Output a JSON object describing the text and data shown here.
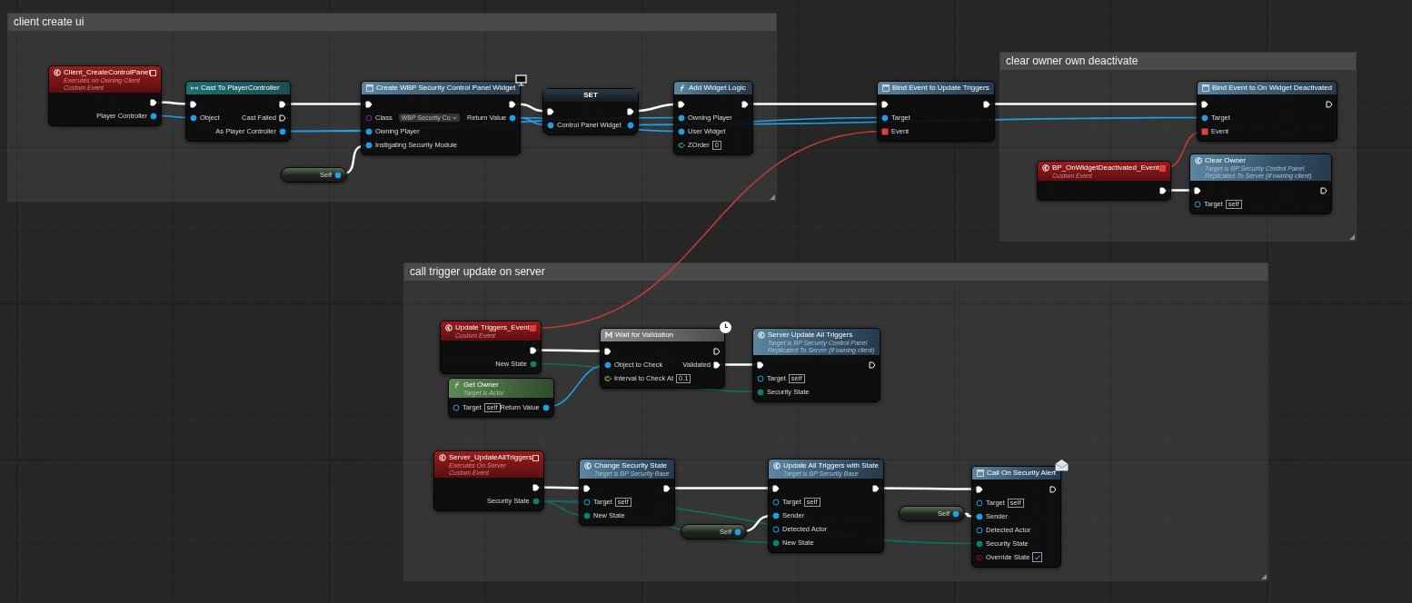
{
  "comments": [
    {
      "title": "client create ui",
      "nodes": [
        {
          "kind": "event",
          "title": "Client_CreateControlPanel",
          "subtitle": [
            "Executes on Owning Client",
            "Custom Event"
          ],
          "delegate": {
            "connected": false
          },
          "outputs": [
            {
              "kind": "exec",
              "connected": true
            },
            {
              "label": "Player Controller",
              "kind": "object",
              "connected": true
            }
          ]
        },
        {
          "kind": "cast",
          "title": "Cast To PlayerController",
          "inputs": [
            {
              "kind": "exec",
              "connected": true
            },
            {
              "label": "Object",
              "kind": "object",
              "connected": true
            }
          ],
          "outputs": [
            {
              "kind": "exec",
              "connected": true
            },
            {
              "label": "Cast Failed",
              "kind": "exec",
              "connected": false
            },
            {
              "label": "As Player Controller",
              "kind": "object",
              "connected": true
            }
          ]
        },
        {
          "kind": "widget",
          "title": "Create WBP Security Control Panel Widget",
          "badge": {
            "kind": "client"
          },
          "inputs": [
            {
              "kind": "exec",
              "connected": true
            },
            {
              "label": "Class",
              "kind": "class",
              "connected": false,
              "value": "WBP Security Co"
            },
            {
              "label": "Owning Player",
              "kind": "object",
              "connected": true
            },
            {
              "label": "Instigating Security Module",
              "kind": "object",
              "connected": true
            }
          ],
          "outputs": [
            {
              "kind": "exec",
              "connected": true
            },
            {
              "label": "Return Value",
              "kind": "object",
              "connected": true
            }
          ]
        },
        {
          "kind": "set",
          "title": "SET",
          "inputs": [
            {
              "kind": "exec",
              "connected": true
            },
            {
              "label": "Control Panel Widget",
              "kind": "object",
              "connected": true
            }
          ],
          "outputs": [
            {
              "kind": "exec",
              "connected": true
            },
            {
              "kind": "object",
              "connected": true
            }
          ]
        },
        {
          "kind": "function",
          "title": "Add Widget Logic",
          "inputs": [
            {
              "kind": "exec",
              "connected": true
            },
            {
              "label": "Owning Player",
              "kind": "object",
              "connected": true
            },
            {
              "label": "User Widget",
              "kind": "object",
              "connected": true
            },
            {
              "label": "ZOrder",
              "kind": "int",
              "connected": false,
              "value": "0"
            }
          ],
          "outputs": [
            {
              "kind": "exec",
              "connected": true
            }
          ]
        },
        {
          "kind": "widget",
          "title": "Bind Event to Update Triggers",
          "inputs": [
            {
              "kind": "exec",
              "connected": true
            },
            {
              "label": "Target",
              "kind": "object",
              "connected": true
            },
            {
              "label": "Event",
              "kind": "delegate",
              "connected": true
            }
          ],
          "outputs": [
            {
              "kind": "exec",
              "connected": true
            }
          ]
        },
        {
          "kind": "self",
          "outputs": [
            {
              "label": "Self",
              "kind": "object",
              "connected": true
            }
          ]
        }
      ]
    },
    {
      "title": "clear owner own deactivate",
      "nodes": [
        {
          "kind": "widget",
          "title": "Bind Event to On Widget Deactivated",
          "inputs": [
            {
              "kind": "exec",
              "connected": true
            },
            {
              "label": "Target",
              "kind": "object",
              "connected": true
            },
            {
              "label": "Event",
              "kind": "delegate",
              "connected": true
            }
          ],
          "outputs": [
            {
              "kind": "exec",
              "connected": false
            }
          ]
        },
        {
          "kind": "event",
          "title": "BP_OnWidgetDeactivated_Event",
          "subtitle": [
            "Custom Event"
          ],
          "delegate": {
            "connected": true
          },
          "outputs": [
            {
              "kind": "exec",
              "connected": true
            }
          ]
        },
        {
          "kind": "call",
          "title": "Clear Owner",
          "subtitle": [
            "Target is BP Security Control Panel",
            "Replicated To Server (if owning client)"
          ],
          "inputs": [
            {
              "kind": "exec",
              "connected": true
            },
            {
              "label": "Target",
              "kind": "object",
              "connected": false,
              "value": "self"
            }
          ],
          "outputs": [
            {
              "kind": "exec",
              "connected": false
            }
          ]
        }
      ]
    },
    {
      "title": "call trigger update on server",
      "nodes": [
        {
          "kind": "event",
          "title": "Update Triggers_Event",
          "subtitle": [
            "Custom Event"
          ],
          "delegate": {
            "connected": true
          },
          "outputs": [
            {
              "kind": "exec",
              "connected": true
            },
            {
              "label": "New State",
              "kind": "enum",
              "connected": true
            }
          ]
        },
        {
          "kind": "macro",
          "title": "Wait for Validation",
          "badge": {
            "kind": "latent"
          },
          "inputs": [
            {
              "kind": "exec",
              "connected": true
            },
            {
              "label": "Object to Check",
              "kind": "object",
              "connected": true
            },
            {
              "label": "Interval to Check At",
              "kind": "float",
              "connected": false,
              "value": "0.1"
            }
          ],
          "outputs": [
            {
              "kind": "exec",
              "connected": false
            },
            {
              "label": "Validated",
              "kind": "exec",
              "connected": true
            }
          ]
        },
        {
          "kind": "call",
          "title": "Server Update All Triggers",
          "subtitle": [
            "Target is BP Security Control Panel",
            "Replicated To Server (if owning client)"
          ],
          "inputs": [
            {
              "kind": "exec",
              "connected": true
            },
            {
              "label": "Target",
              "kind": "object",
              "connected": false,
              "value": "self"
            },
            {
              "label": "Security State",
              "kind": "enum",
              "connected": true
            }
          ],
          "outputs": [
            {
              "kind": "exec",
              "connected": false
            }
          ]
        },
        {
          "kind": "pure",
          "title": "Get Owner",
          "subtitle": [
            "Target is Actor"
          ],
          "inputs": [
            {
              "label": "Target",
              "kind": "object",
              "connected": false,
              "value": "self"
            }
          ],
          "outputs": [
            {
              "label": "Return Value",
              "kind": "object",
              "connected": true
            }
          ]
        },
        {
          "kind": "event",
          "title": "Server_UpdateAllTriggers",
          "subtitle": [
            "Executes On Server",
            "Custom Event"
          ],
          "delegate": {
            "connected": false
          },
          "outputs": [
            {
              "kind": "exec",
              "connected": true
            },
            {
              "label": "Security State",
              "kind": "enum",
              "connected": true
            }
          ]
        },
        {
          "kind": "call",
          "title": "Change Security State",
          "subtitle": [
            "Target is BP Security Base"
          ],
          "inputs": [
            {
              "kind": "exec",
              "connected": true
            },
            {
              "label": "Target",
              "kind": "object",
              "connected": false,
              "value": "self"
            },
            {
              "label": "New State",
              "kind": "enum",
              "connected": true
            }
          ],
          "outputs": [
            {
              "kind": "exec",
              "connected": true
            }
          ]
        },
        {
          "kind": "call",
          "title": "Update All Triggers with State",
          "subtitle": [
            "Target is BP Security Base"
          ],
          "inputs": [
            {
              "kind": "exec",
              "connected": true
            },
            {
              "label": "Target",
              "kind": "object",
              "connected": false,
              "value": "self"
            },
            {
              "label": "Sender",
              "kind": "object",
              "connected": true
            },
            {
              "label": "Detected Actor",
              "kind": "object",
              "connected": false
            },
            {
              "label": "New State",
              "kind": "enum",
              "connected": true
            }
          ],
          "outputs": [
            {
              "kind": "exec",
              "connected": true
            }
          ]
        },
        {
          "kind": "self",
          "outputs": [
            {
              "label": "Self",
              "kind": "object",
              "connected": true
            }
          ]
        },
        {
          "kind": "self",
          "outputs": [
            {
              "label": "Self",
              "kind": "object",
              "connected": true
            }
          ]
        },
        {
          "kind": "widget",
          "title": "Call On Security Alert",
          "badge": {
            "kind": "message"
          },
          "inputs": [
            {
              "kind": "exec",
              "connected": true
            },
            {
              "label": "Target",
              "kind": "object",
              "connected": false,
              "value": "self"
            },
            {
              "label": "Sender",
              "kind": "object",
              "connected": true
            },
            {
              "label": "Detected Actor",
              "kind": "object",
              "connected": false
            },
            {
              "label": "Security State",
              "kind": "enum",
              "connected": true
            },
            {
              "label": "Override State",
              "kind": "bool",
              "connected": false,
              "checked": true
            }
          ],
          "outputs": [
            {
              "kind": "exec",
              "connected": false
            }
          ]
        }
      ]
    }
  ]
}
